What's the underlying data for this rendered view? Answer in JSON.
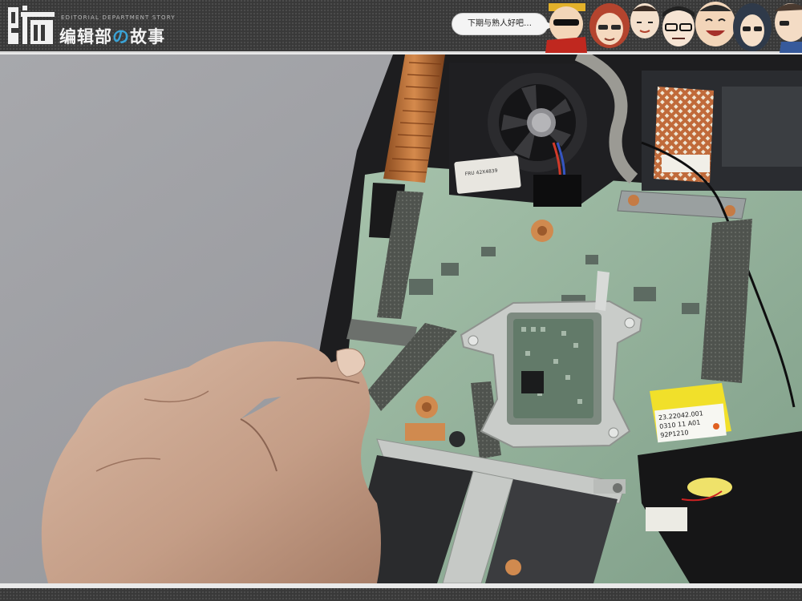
{
  "header": {
    "logo_char": "编",
    "brand_subtitle": "EDITORIAL DEPARTMENT STORY",
    "brand_title_part1": "编辑部",
    "brand_title_accent": "の",
    "brand_title_part2": "故事",
    "speech_bubble": "下期与熟人好吧…"
  },
  "colors": {
    "header_bg": "#393939",
    "accent": "#3aa3d6",
    "board_green": "#8fae97",
    "copper": "#c8773a"
  },
  "photo": {
    "sticker_line1": "23.22042.001",
    "sticker_line2": "0310 11 A01",
    "sticker_line3": "92P1210",
    "fan_label": "FRU 42X4839"
  }
}
